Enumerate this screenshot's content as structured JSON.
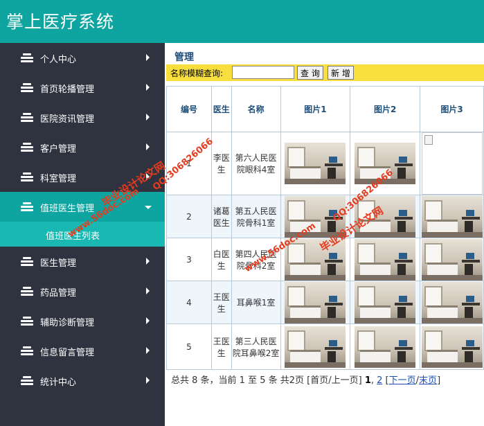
{
  "app": {
    "title": "掌上医疗系统"
  },
  "sidebar": {
    "items": [
      {
        "label": "个人中心",
        "active": false
      },
      {
        "label": "首页轮播管理",
        "active": false
      },
      {
        "label": "医院资讯管理",
        "active": false
      },
      {
        "label": "客户管理",
        "active": false
      },
      {
        "label": "科室管理",
        "active": false
      },
      {
        "label": "值班医生管理",
        "active": true
      },
      {
        "label": "医生管理",
        "active": false
      },
      {
        "label": "药品管理",
        "active": false
      },
      {
        "label": "辅助诊断管理",
        "active": false
      },
      {
        "label": "信息留言管理",
        "active": false
      },
      {
        "label": "统计中心",
        "active": false
      }
    ],
    "sub_item": {
      "label": "值班医生列表"
    }
  },
  "main": {
    "title": "管理",
    "search": {
      "label": "名称模糊查询:",
      "value": "",
      "search_button": "查 询",
      "add_button": "新 增"
    },
    "table": {
      "headers": [
        "编号",
        "医生",
        "名称",
        "图片1",
        "图片2",
        "图片3"
      ],
      "rows": [
        {
          "id": "1",
          "doctor": "李医生",
          "name": "第六人民医院眼科4室",
          "pic3_broken": true
        },
        {
          "id": "2",
          "doctor": "诸葛医生",
          "name": "第五人民医院骨科1室",
          "pic3_broken": false
        },
        {
          "id": "3",
          "doctor": "白医生",
          "name": "第四人民医院骨科2室",
          "pic3_broken": false
        },
        {
          "id": "4",
          "doctor": "王医生",
          "name": "耳鼻喉1室",
          "pic3_broken": false
        },
        {
          "id": "5",
          "doctor": "王医生",
          "name": "第三人民医院耳鼻喉2室",
          "pic3_broken": false
        }
      ]
    },
    "pager": {
      "summary": "总共 8 条，当前 1 至 5 条 共2页",
      "first_prev": "[首页/上一页]",
      "current_page": "1",
      "page2": "2",
      "next": "下一页",
      "last": "末页"
    }
  },
  "watermark": {
    "line1": "毕业设计论文网",
    "line2": "www.56doc.com",
    "line3": "QQ:306826066"
  },
  "colors": {
    "accent": "#0ea5a0",
    "sidebar_bg": "#2f3340",
    "search_bar": "#f9df3d",
    "watermark": "#e53b1f"
  }
}
